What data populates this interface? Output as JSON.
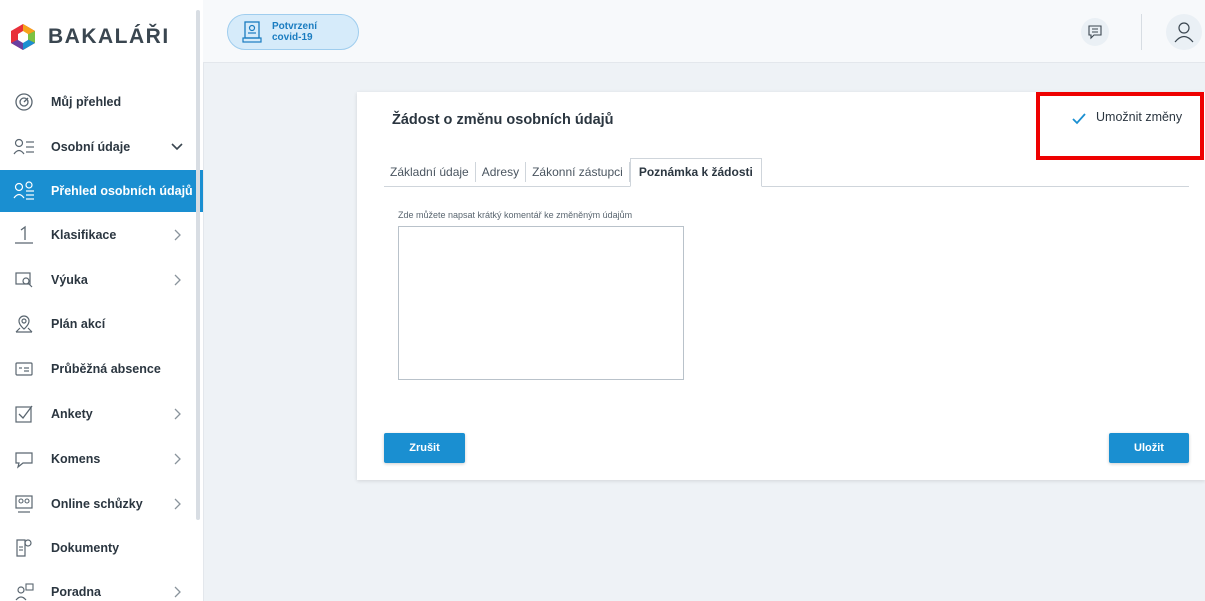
{
  "app": {
    "name": "BAKALÁŘI"
  },
  "topbar": {
    "covid_button": "Potvrzení covid-19"
  },
  "sidebar": {
    "items": [
      {
        "label": "Můj přehled",
        "icon": "dashboard-icon"
      },
      {
        "label": "Osobní údaje",
        "icon": "personal-data-icon",
        "expanded": true
      },
      {
        "label": "Přehled osobních údajů",
        "icon": "personal-data-overview-icon",
        "active": true
      },
      {
        "label": "Klasifikace",
        "icon": "grades-icon"
      },
      {
        "label": "Výuka",
        "icon": "teaching-icon"
      },
      {
        "label": "Plán akcí",
        "icon": "events-icon"
      },
      {
        "label": "Průběžná absence",
        "icon": "absence-icon"
      },
      {
        "label": "Ankety",
        "icon": "surveys-icon"
      },
      {
        "label": "Komens",
        "icon": "messages-icon"
      },
      {
        "label": "Online schůzky",
        "icon": "online-meetings-icon"
      },
      {
        "label": "Dokumenty",
        "icon": "documents-icon"
      },
      {
        "label": "Poradna",
        "icon": "counseling-icon"
      }
    ]
  },
  "form": {
    "title": "Žádost o změnu osobních údajů",
    "allow_changes": "Umožnit změny",
    "tabs": [
      {
        "label": "Základní údaje"
      },
      {
        "label": "Adresy"
      },
      {
        "label": "Zákonní zástupci"
      },
      {
        "label": "Poznámka k žádosti",
        "active": true
      }
    ],
    "note_label": "Zde můžete napsat krátký komentář ke změněným údajům",
    "note_value": "",
    "cancel_label": "Zrušit",
    "save_label": "Uložit"
  },
  "colors": {
    "accent": "#1a8fd1",
    "highlight": "#ee0000"
  }
}
